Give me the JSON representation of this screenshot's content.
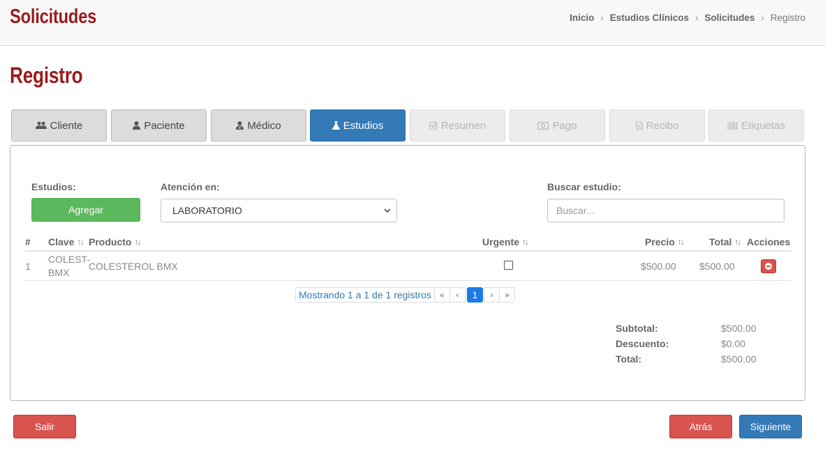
{
  "header": {
    "title": "Solicitudes",
    "breadcrumb": [
      "Inicio",
      "Estudios Clínicos",
      "Solicitudes",
      "Registro"
    ],
    "separator": "›"
  },
  "page_title": "Registro",
  "steps": [
    {
      "label": "Cliente",
      "icon": "users-icon",
      "state": "default"
    },
    {
      "label": "Paciente",
      "icon": "user-icon",
      "state": "default"
    },
    {
      "label": "Médico",
      "icon": "doctor-icon",
      "state": "default"
    },
    {
      "label": "Estudios",
      "icon": "flask-icon",
      "state": "active"
    },
    {
      "label": "Resumen",
      "icon": "check-square-icon",
      "state": "disabled"
    },
    {
      "label": "Pago",
      "icon": "money-icon",
      "state": "disabled"
    },
    {
      "label": "Recibo",
      "icon": "file-icon",
      "state": "disabled"
    },
    {
      "label": "Etiquetas",
      "icon": "barcode-icon",
      "state": "disabled"
    }
  ],
  "form": {
    "estudios_label": "Estudios:",
    "add_button": "Agregar",
    "atencion_label": "Atención en:",
    "atencion_value": "LABORATORIO",
    "search_label": "Buscar estudio:",
    "search_placeholder": "Buscar..."
  },
  "table": {
    "columns": [
      "#",
      "Clave",
      "Producto",
      "Urgente",
      "Precio",
      "Total",
      "Acciones"
    ],
    "rows": [
      {
        "num": "1",
        "clave_line1": "COLEST-",
        "clave_line2": "BMX",
        "producto": "COLESTEROL BMX",
        "urgente": false,
        "precio": "$500.00",
        "total": "$500.00"
      }
    ]
  },
  "pagination": {
    "info": "Mostrando 1 a 1 de 1 registros",
    "first": "«",
    "prev": "‹",
    "current": "1",
    "next": "›",
    "last": "»"
  },
  "totals": {
    "subtotal_label": "Subtotal:",
    "subtotal": "$500.00",
    "descuento_label": "Descuento:",
    "descuento": "$0.00",
    "total_label": "Total:",
    "total": "$500.00"
  },
  "footer": {
    "exit": "Salir",
    "back": "Atrás",
    "next": "Siguiente"
  },
  "colors": {
    "brand_red": "#9b1c1c",
    "primary": "#337ab7",
    "success": "#5cb85c",
    "danger": "#d9534f"
  }
}
